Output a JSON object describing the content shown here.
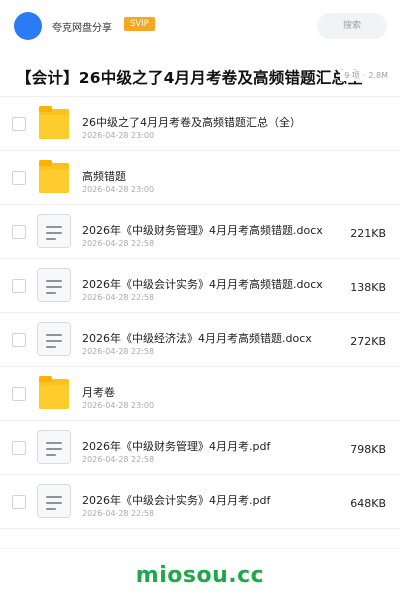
{
  "header": {
    "username": "夸克网盘分享",
    "badge": "SVIP",
    "search_placeholder": "搜索"
  },
  "folder_info": {
    "title": "【会计】26中级之了4月月考卷及高频错题汇总全",
    "item_count": "9 项",
    "total_size": "2.8M"
  },
  "files": [
    {
      "type": "folder",
      "name": "26中级之了4月月考卷及高频错题汇总（全）",
      "date": "2026-04-28 23:00",
      "size": ""
    },
    {
      "type": "folder",
      "name": "高频错题",
      "date": "2026-04-28 23:00",
      "size": ""
    },
    {
      "type": "doc",
      "name": "2026年《中级财务管理》4月月考高频错题.docx",
      "date": "2026-04-28 22:58",
      "size": "221KB"
    },
    {
      "type": "doc",
      "name": "2026年《中级会计实务》4月月考高频错题.docx",
      "date": "2026-04-28 22:58",
      "size": "138KB"
    },
    {
      "type": "doc",
      "name": "2026年《中级经济法》4月月考高频错题.docx",
      "date": "2026-04-28 22:58",
      "size": "272KB"
    },
    {
      "type": "folder",
      "name": "月考卷",
      "date": "2026-04-28 23:00",
      "size": ""
    },
    {
      "type": "doc",
      "name": "2026年《中级财务管理》4月月考.pdf",
      "date": "2026-04-28 22:58",
      "size": "798KB"
    },
    {
      "type": "doc",
      "name": "2026年《中级会计实务》4月月考.pdf",
      "date": "2026-04-28 22:58",
      "size": "648KB"
    }
  ],
  "watermark": "miosou.cc",
  "colors": {
    "avatar": "#2b7bf5",
    "badge": "#f5a623",
    "folder": "#ffc21a",
    "watermark": "#1fa84a"
  }
}
